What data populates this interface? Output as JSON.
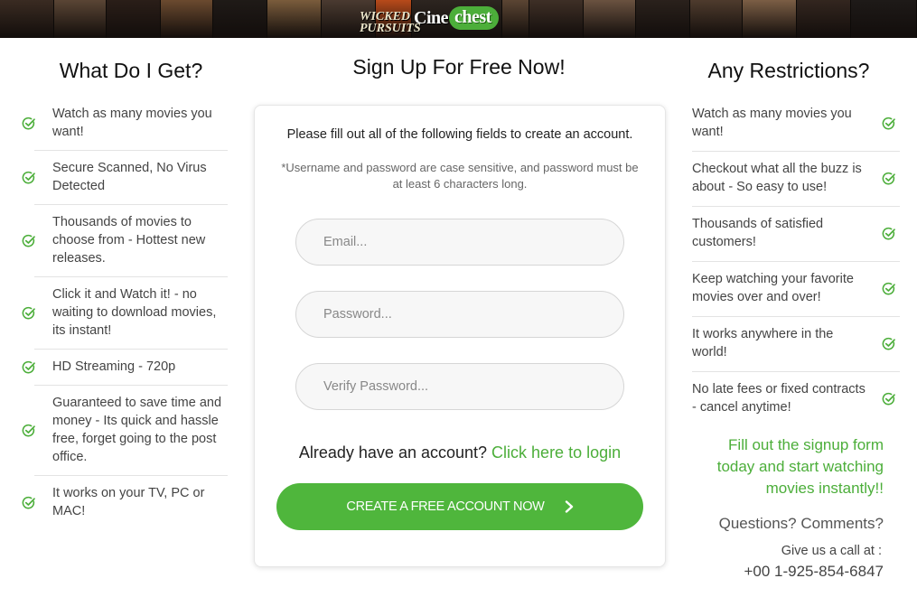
{
  "banner": {
    "logo_part1": "Cine",
    "logo_part2": "chest",
    "poster_caption": "WICKED PURSUITS",
    "poster_colors": [
      "#3a2b22",
      "#5a4535",
      "#2a1e18",
      "#6b4a2f",
      "#1f1a17",
      "#7a5c3c",
      "#4a3a30",
      "#b84a1a",
      "#2d2520",
      "#5b4533",
      "#3e2f26",
      "#6a5240",
      "#2a211c",
      "#4e3b2d",
      "#7b5e45",
      "#33261f",
      "#1e1a18"
    ]
  },
  "left": {
    "title": "What Do I Get?",
    "items": [
      "Watch as many movies you want!",
      "Secure Scanned, No Virus Detected",
      "Thousands of movies to choose from - Hottest new releases.",
      "Click it and Watch it! - no waiting to download movies, its instant!",
      "HD Streaming - 720p",
      "Guaranteed to save time and money - Its quick and hassle free, forget going to the post office.",
      "It works on your TV, PC or MAC!"
    ]
  },
  "center": {
    "title": "Sign Up For Free Now!",
    "intro": "Please fill out all of the following fields to create an account.",
    "note": "*Username and password are case sensitive, and password must be at least 6 characters long.",
    "email_placeholder": "Email...",
    "password_placeholder": "Password...",
    "verify_placeholder": "Verify Password...",
    "login_prompt": "Already have an account?",
    "login_link": "Click here to login",
    "cta_label": "CREATE A FREE ACCOUNT NOW"
  },
  "right": {
    "title": "Any Restrictions?",
    "items": [
      "Watch as many movies you want!",
      "Checkout what all the buzz is about - So easy to use!",
      "Thousands of satisfied customers!",
      "Keep watching your favorite movies over and over!",
      "It works anywhere in the world!",
      "No late fees or fixed contracts - cancel anytime!"
    ],
    "promo": "Fill out the signup form today and start watching movies instantly!!",
    "questions": "Questions? Comments?",
    "call_label": "Give us a call at :",
    "phone": "+00 1-925-854-6847"
  },
  "colors": {
    "accent_green": "#4cae3a",
    "button_green": "#4fb63c",
    "text_dark": "#222222"
  },
  "icons": {
    "list_bullet": "check-circle-icon",
    "cta_arrow": "chevron-right-icon"
  }
}
